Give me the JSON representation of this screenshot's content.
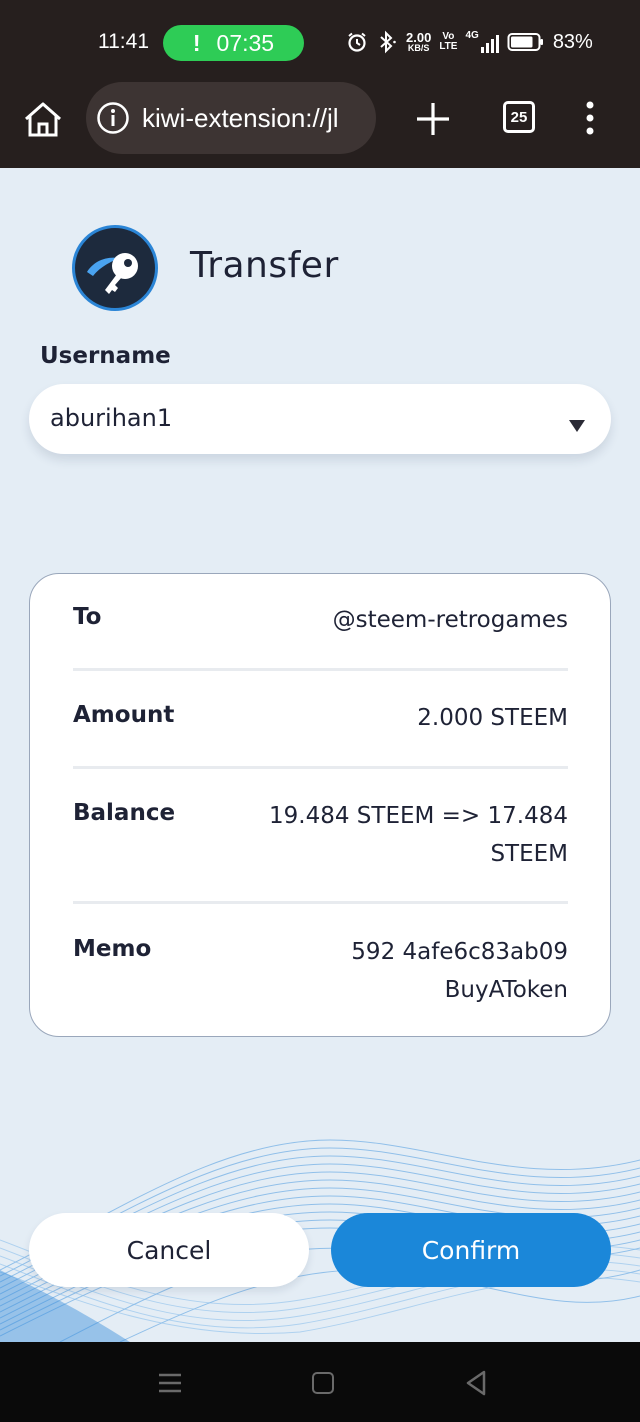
{
  "status_bar": {
    "time": "11:41",
    "call_timer": "07:35",
    "call_glyph": "!",
    "net_speed_value": "2.00",
    "net_speed_unit": "KB/S",
    "volte_top": "Vo",
    "volte_bottom": "LTE",
    "network": "4G",
    "battery_percent": "83%",
    "icons": [
      "alarm-icon",
      "bluetooth-icon",
      "signal-icon",
      "battery-icon"
    ]
  },
  "browser": {
    "url": "kiwi-extension://jl",
    "tab_count": "25",
    "icons": [
      "home-icon",
      "info-icon",
      "plus-icon",
      "menu-dots-icon"
    ]
  },
  "header": {
    "title": "Transfer",
    "logo_icon": "key-logo-icon"
  },
  "username": {
    "label": "Username",
    "value": "aburihan1"
  },
  "details": {
    "rows": [
      {
        "label": "To",
        "value": "@steem-retrogames"
      },
      {
        "label": "Amount",
        "value": "2.000 STEEM"
      },
      {
        "label": "Balance",
        "value_line1": "19.484 STEEM => 17.484",
        "value_line2": "STEEM"
      },
      {
        "label": "Memo",
        "value_line1": "592 4afe6c83ab09",
        "value_line2": "BuyAToken"
      }
    ]
  },
  "actions": {
    "cancel_label": "Cancel",
    "confirm_label": "Confirm"
  },
  "colors": {
    "background": "#e4edf5",
    "accent": "#1b87d9",
    "text": "#1e2235",
    "bar": "#261f1e",
    "call_pill": "#2ecc56"
  }
}
